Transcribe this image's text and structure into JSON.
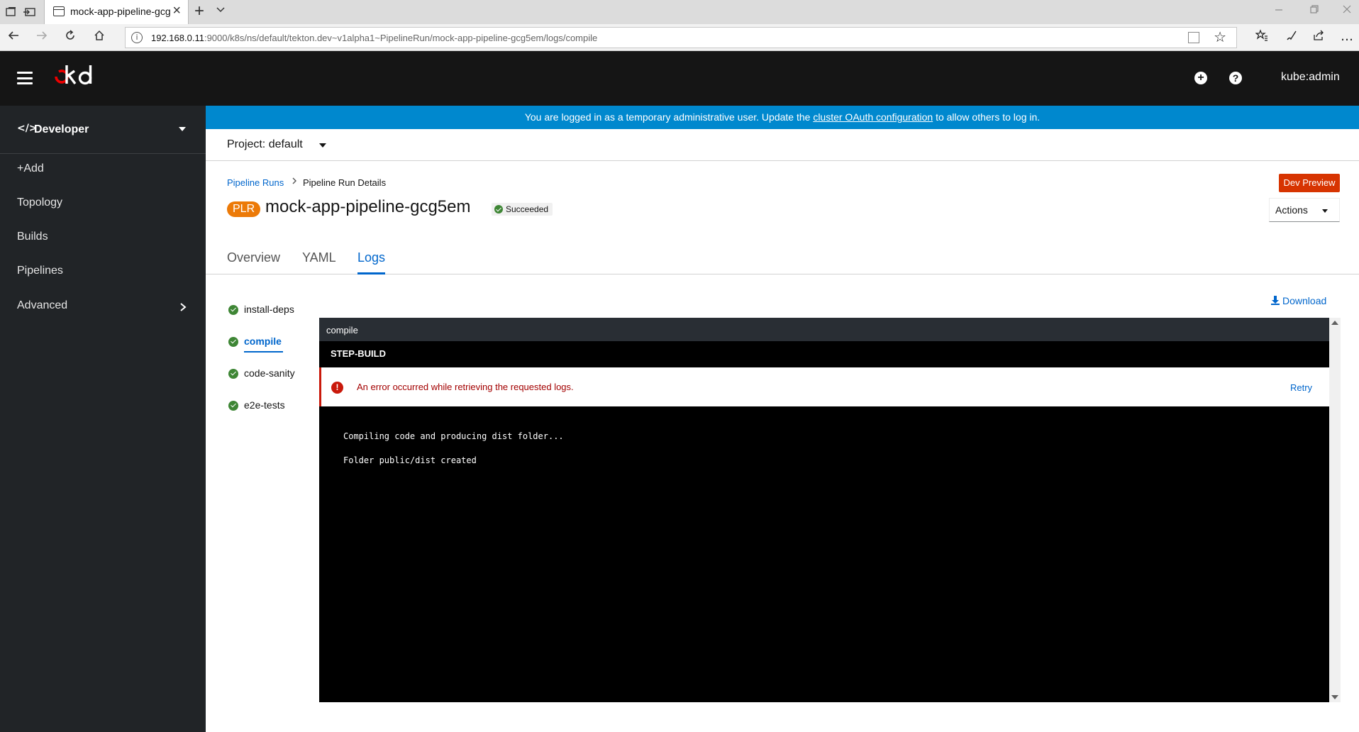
{
  "browser": {
    "tab_title": "mock-app-pipeline-gcg",
    "url_host": "192.168.0.11",
    "url_rest": ":9000/k8s/ns/default/tekton.dev~v1alpha1~PipelineRun/mock-app-pipeline-gcg5em/logs/compile"
  },
  "masthead": {
    "logo": "okd",
    "user": "kube:admin"
  },
  "sidebar": {
    "perspective": "Developer",
    "items": [
      {
        "label": "+Add"
      },
      {
        "label": "Topology"
      },
      {
        "label": "Builds"
      },
      {
        "label": "Pipelines"
      },
      {
        "label": "Advanced"
      }
    ]
  },
  "banner": {
    "before": "You are logged in as a temporary administrative user. Update the ",
    "link": "cluster OAuth configuration",
    "after": " to allow others to log in."
  },
  "project": {
    "label": "Project: default"
  },
  "breadcrumb": {
    "parent": "Pipeline Runs",
    "current": "Pipeline Run Details"
  },
  "header": {
    "badge": "PLR",
    "title": "mock-app-pipeline-gcg5em",
    "status": "Succeeded",
    "dev_preview": "Dev Preview",
    "actions": "Actions"
  },
  "tabs": [
    {
      "label": "Overview"
    },
    {
      "label": "YAML"
    },
    {
      "label": "Logs",
      "active": true
    }
  ],
  "tasks": [
    {
      "label": "install-deps",
      "status": "succeeded"
    },
    {
      "label": "compile",
      "status": "succeeded",
      "active": true
    },
    {
      "label": "code-sanity",
      "status": "succeeded"
    },
    {
      "label": "e2e-tests",
      "status": "succeeded"
    }
  ],
  "logs": {
    "download": "Download",
    "task_name": "compile",
    "step": "STEP-BUILD",
    "error": "An error occurred while retrieving the requested logs.",
    "retry": "Retry",
    "lines": [
      "Compiling code and producing dist folder...",
      "Folder public/dist created"
    ]
  },
  "colors": {
    "masthead": "#151515",
    "sidebar": "#212427",
    "banner": "#0088ce",
    "link": "#0066cc",
    "success": "#3e8635",
    "danger": "#c9190b",
    "plr_badge": "#ec7a08",
    "dev_preview": "#d73401"
  }
}
